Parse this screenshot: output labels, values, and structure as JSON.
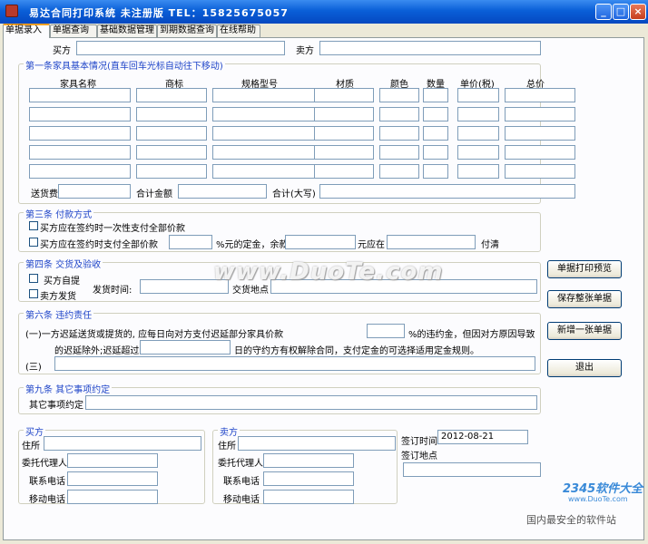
{
  "window": {
    "title": "易达合同打印系统 未注册版 TEL：15825675057",
    "min": "_",
    "max": "□",
    "close": "×"
  },
  "tabs": [
    "单据录入",
    "单据查询",
    "基础数据管理",
    "到期数据查询",
    "在线帮助"
  ],
  "top": {
    "buyer_label": "买方",
    "seller_label": "卖方"
  },
  "goods": {
    "section": "第一条家具基本情况(直车回车光标自动往下移动)",
    "cols": [
      "家具名称",
      "商标",
      "规格型号",
      "材质",
      "颜色",
      "数量",
      "单价(税)",
      "总价"
    ],
    "shipping_label": "送货费",
    "sum_label": "合计金额",
    "sum_caps_label": "合计(大写)"
  },
  "payment": {
    "section": "第三条 付款方式",
    "opt1": "买方应在签约时一次性支付全部价款",
    "opt2": "买方应在签约时支付全部价款",
    "mid1": "%元的定金，余款",
    "mid2": "元应在",
    "end": "付清"
  },
  "delivery": {
    "section": "第四条 交货及验收",
    "opt1": "买方自提",
    "opt2": "卖方发货",
    "time_label": "发货时间:",
    "place_label": "交货地点"
  },
  "breach": {
    "section": "第六条 违约责任",
    "line1": "(一)一方迟延送货或提货的, 应每日向对方支付迟延部分家具价款",
    "line1b": "%的违约金，但因对方原因导致",
    "line2a": "的迟延除外;迟延超过",
    "line2b": "日的守约方有权解除合同，支付定金的可选择适用定金规则。",
    "line3": "(三)"
  },
  "other": {
    "section": "第九条 其它事项约定",
    "label": "其它事项约定"
  },
  "buyer": {
    "section": "买方",
    "addr": "住所",
    "agent": "委托代理人",
    "phone": "联系电话",
    "mobile": "移动电话"
  },
  "seller": {
    "section": "卖方",
    "addr": "住所",
    "agent": "委托代理人",
    "phone": "联系电话",
    "mobile": "移动电话"
  },
  "sign": {
    "time_label": "签订时间",
    "time_value": "2012-08-21",
    "place_label": "签订地点"
  },
  "buttons": {
    "print": "单据打印预览",
    "save": "保存整张单据",
    "new": "新增一张单据",
    "exit": "退出"
  },
  "watermark": {
    "main": "www.DuoTe.com",
    "brand": "2345软件大全",
    "url": "www.DuoTe.com",
    "slogan": "国内最安全的软件站"
  }
}
